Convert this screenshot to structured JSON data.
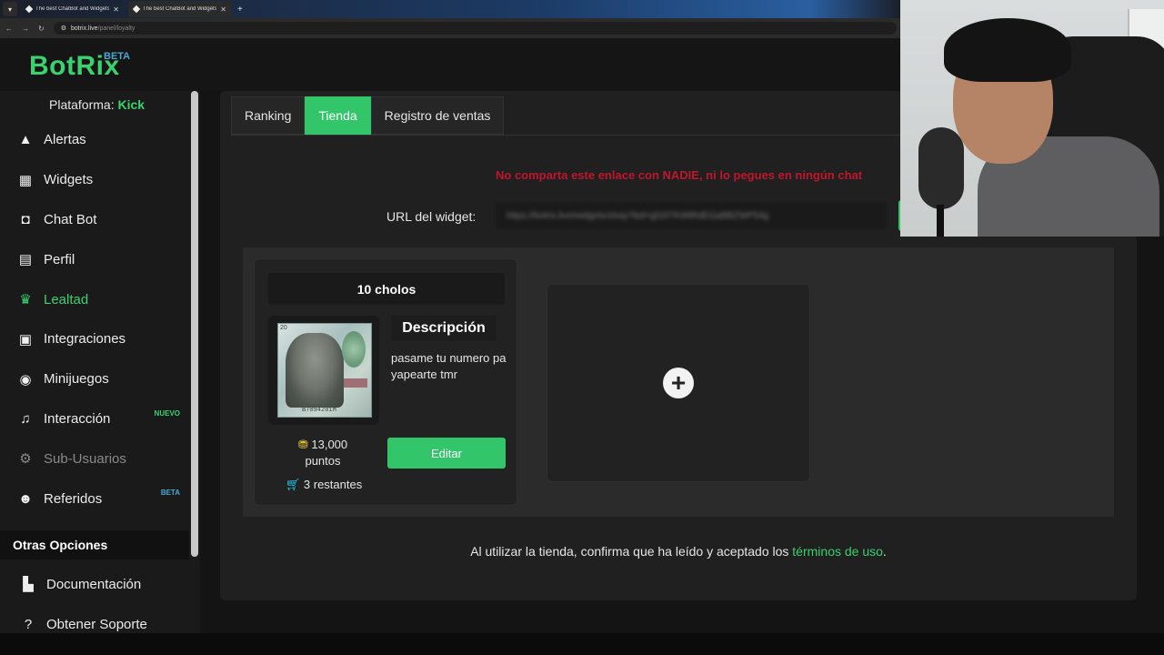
{
  "browser": {
    "tabs": [
      {
        "title": "The best ChatBot and Widgets",
        "active": false
      },
      {
        "title": "The best ChatBot and Widgets",
        "active": true
      }
    ],
    "url_host": "botrix.live",
    "url_path": "/panel/loyalty"
  },
  "app": {
    "logo": "BotRix",
    "beta": "BETA"
  },
  "sidebar": {
    "platform_label": "Plataforma:",
    "platform_value": "Kick",
    "items": [
      {
        "label": "Alertas",
        "icon": "warning-icon",
        "state": "normal",
        "badge": ""
      },
      {
        "label": "Widgets",
        "icon": "grid-icon",
        "state": "normal",
        "badge": ""
      },
      {
        "label": "Chat Bot",
        "icon": "robot-icon",
        "state": "normal",
        "badge": ""
      },
      {
        "label": "Perfil",
        "icon": "id-card-icon",
        "state": "normal",
        "badge": ""
      },
      {
        "label": "Lealtad",
        "icon": "trophy-icon",
        "state": "active",
        "badge": ""
      },
      {
        "label": "Integraciones",
        "icon": "chat-square-icon",
        "state": "normal",
        "badge": ""
      },
      {
        "label": "Minijuegos",
        "icon": "gamepad-icon",
        "state": "normal",
        "badge": ""
      },
      {
        "label": "Interacción",
        "icon": "music-icon",
        "state": "normal",
        "badge": "NUEVO"
      },
      {
        "label": "Sub-Usuarios",
        "icon": "gears-icon",
        "state": "muted",
        "badge": ""
      },
      {
        "label": "Referidos",
        "icon": "users-icon",
        "state": "normal",
        "badge": "BETA"
      }
    ],
    "section_title": "Otras Opciones",
    "other_items": [
      {
        "label": "Documentación",
        "icon": "book-icon"
      },
      {
        "label": "Obtener Soporte",
        "icon": "question-circle-icon"
      }
    ]
  },
  "tabs": [
    {
      "label": "Ranking",
      "active": false
    },
    {
      "label": "Tienda",
      "active": true
    },
    {
      "label": "Registro de ventas",
      "active": false
    }
  ],
  "widget": {
    "warning": "No comparta este enlace con NADIE, ni lo pegues en ningún chat",
    "url_label": "URL del widget:",
    "url_value": "https://botrix.live/widgets/shop?bid=gD2l7KWtRdEGaBBZWP54g"
  },
  "shop": {
    "item": {
      "title": "10 cholos",
      "description_title": "Descripción",
      "description": "pasame tu numero pa yapearte tmr",
      "price_value": "13,000",
      "price_unit": "puntos",
      "remaining": "3 restantes",
      "edit_label": "Editar",
      "image_serial": "B7094201M",
      "image_corner": "20"
    },
    "add_icon": "plus-circle-icon"
  },
  "terms": {
    "text": "Al utilizar la tienda, confirma que ha leído y aceptado los",
    "link": "términos de uso",
    "end": "."
  },
  "colors": {
    "accent": "#33c56a",
    "warning": "#c0162d",
    "beta": "#4aa8d8"
  }
}
